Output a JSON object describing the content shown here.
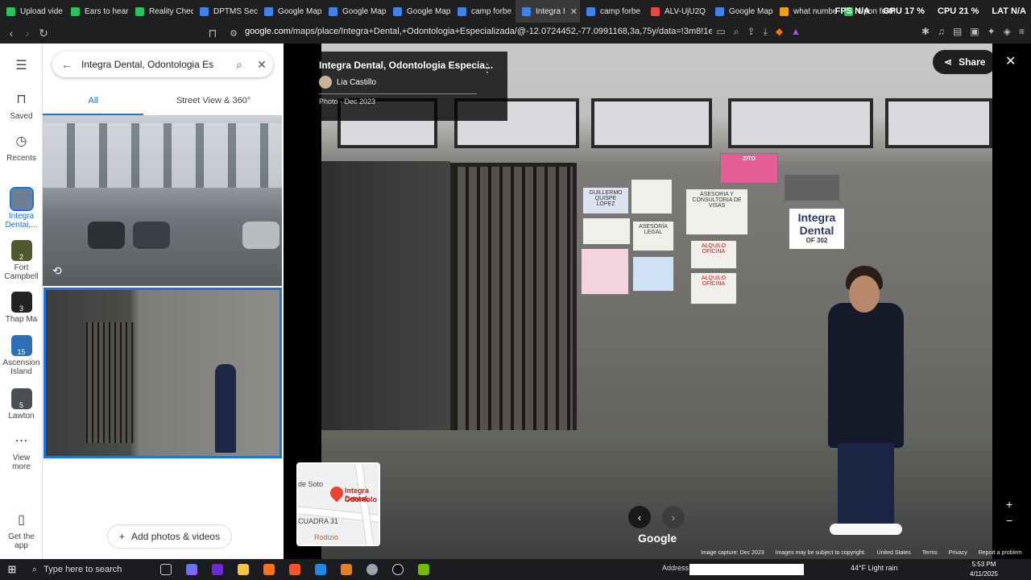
{
  "browser": {
    "tabs": [
      {
        "label": "Upload vide",
        "color": "#22c55e"
      },
      {
        "label": "Ears to hear",
        "color": "#22c55e"
      },
      {
        "label": "Reality Check",
        "color": "#22c55e"
      },
      {
        "label": "DPTMS Secu",
        "color": "#3b82f6"
      },
      {
        "label": "Google Maps",
        "color": "#3b82f6"
      },
      {
        "label": "Google Maps",
        "color": "#3b82f6"
      },
      {
        "label": "Google Maps",
        "color": "#3b82f6"
      },
      {
        "label": "camp forbe",
        "color": "#3b82f6"
      },
      {
        "label": "Integra I",
        "color": "#3b82f6",
        "active": true
      },
      {
        "label": "camp forbe",
        "color": "#3b82f6"
      },
      {
        "label": "ALV-UjU2Q",
        "color": "#ef4444"
      },
      {
        "label": "Google Maps",
        "color": "#3b82f6"
      },
      {
        "label": "what numbe",
        "color": "#f59e0b"
      },
      {
        "label": "Upon furth",
        "color": "#22c55e"
      }
    ],
    "url_domain": "google.com",
    "url_path": "/maps/place/Integra+Dental,+Odontologia+Especializada/@-12.0724452,-77.0991168,3a,75y/data=!3m8!1e2!3m6!1sCIHM0o...",
    "system_stats": [
      {
        "label": "FPS",
        "value": "N/A"
      },
      {
        "label": "GPU",
        "value": "17 %"
      },
      {
        "label": "CPU",
        "value": "21 %"
      },
      {
        "label": "LAT",
        "value": "N/A"
      }
    ]
  },
  "rail": {
    "menu_label": "Menu",
    "items": [
      {
        "label": "Saved"
      },
      {
        "label": "Recents"
      },
      {
        "label": "Integra Dental,..."
      },
      {
        "label": "Fort Campbell",
        "badge": "2"
      },
      {
        "label": "Thap Ma",
        "badge": "3"
      },
      {
        "label": "Ascension Island",
        "badge": "15"
      },
      {
        "label": "Lawton",
        "badge": "5"
      },
      {
        "label": "View more"
      },
      {
        "label": "Get the app"
      }
    ]
  },
  "panel": {
    "search_value": "Integra Dental, Odontologia Es",
    "tabs": [
      {
        "label": "All"
      },
      {
        "label": "Street View & 360°"
      }
    ],
    "add_button_label": "Add photos & videos"
  },
  "viewer": {
    "title": "Integra Dental, Odontologia Especia...",
    "author": "Lia Castillo",
    "date": "Photo · Dec 2023",
    "share_label": "Share",
    "google_label": "Google",
    "minimap_labels": [
      "Integra Dental,",
      "Odontolo",
      "de Soto",
      "CUADRA 31",
      "Rodizio"
    ],
    "signs": {
      "logo_line1": "Integra",
      "logo_line2": "Dental",
      "logo_sub": "OF 302",
      "pink_label": "ZITO",
      "sign_1": "GUILLERMO QUISPE LÓPEZ",
      "sign_2": "ALQUILO OFICINA",
      "sign_3": "ASESORIA Y CONSULTORIA DE VISAS",
      "sign_4": "ASESORÍA LEGAL"
    },
    "footer": [
      "Image capture: Dec 2023",
      "Images may be subject to copyright.",
      "United States",
      "Terms",
      "Privacy",
      "Report a problem"
    ]
  },
  "taskbar": {
    "search_placeholder": "Type here to search",
    "address_label": "Address",
    "weather": "44°F Light rain",
    "time": "5:53 PM",
    "date": "4/11/2025"
  }
}
